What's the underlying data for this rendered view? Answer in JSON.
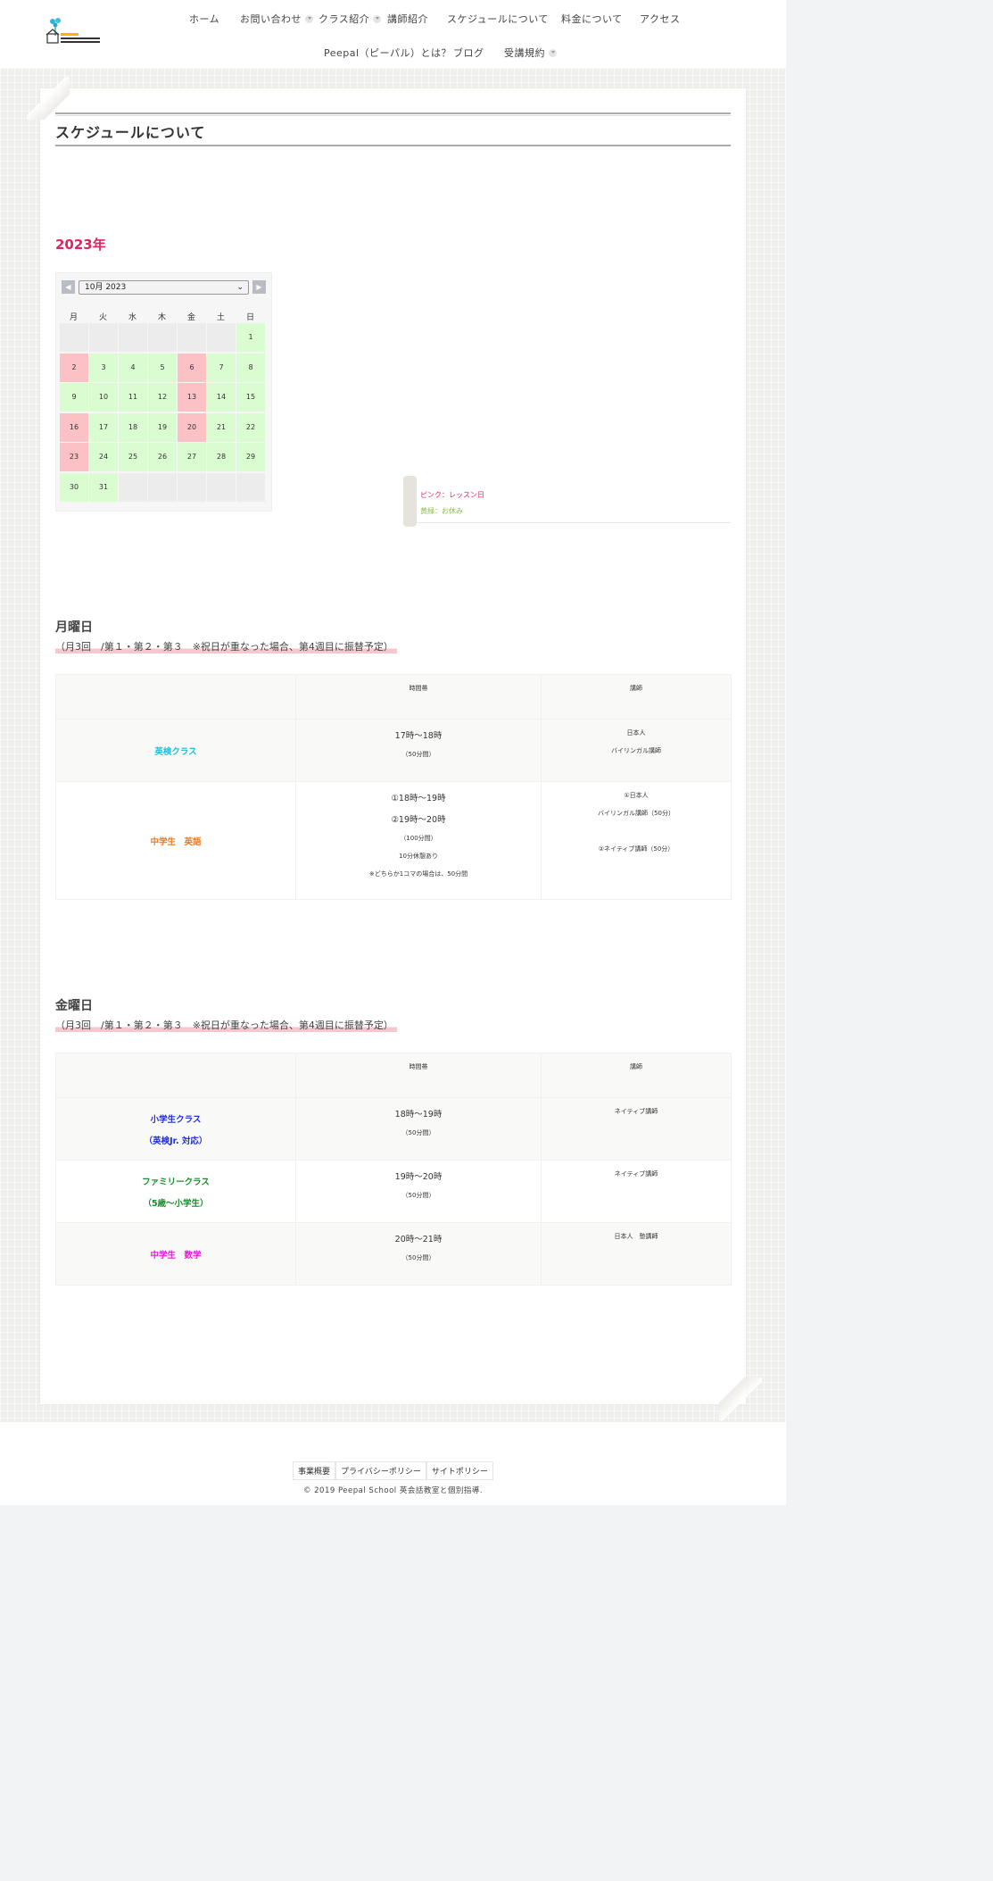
{
  "header": {
    "nav": [
      {
        "label": "ホーム",
        "dropdown": false
      },
      {
        "label": "お問い合わせ",
        "dropdown": true
      },
      {
        "label": "クラス紹介",
        "dropdown": true
      },
      {
        "label": "講師紹介",
        "dropdown": false
      },
      {
        "label": "スケジュールについて",
        "dropdown": false
      },
      {
        "label": "料金について",
        "dropdown": false
      },
      {
        "label": "アクセス",
        "dropdown": false
      },
      {
        "label": "Peepal（ピーパル）とは？",
        "dropdown": false
      },
      {
        "label": "ブログ",
        "dropdown": false
      },
      {
        "label": "受講規約",
        "dropdown": true
      }
    ]
  },
  "page_title": "スケジュールについて",
  "year_heading": "2023年",
  "calendar": {
    "prev_icon": "◀",
    "next_icon": "▶",
    "month_select": "10月 2023",
    "weekdays": [
      "月",
      "火",
      "水",
      "木",
      "金",
      "土",
      "日"
    ],
    "days": [
      {
        "label": "",
        "status": "empty"
      },
      {
        "label": "",
        "status": "empty"
      },
      {
        "label": "",
        "status": "empty"
      },
      {
        "label": "",
        "status": "empty"
      },
      {
        "label": "",
        "status": "empty"
      },
      {
        "label": "",
        "status": "empty"
      },
      {
        "label": "1",
        "status": "off"
      },
      {
        "label": "2",
        "status": "lesson"
      },
      {
        "label": "3",
        "status": "off"
      },
      {
        "label": "4",
        "status": "off"
      },
      {
        "label": "5",
        "status": "off"
      },
      {
        "label": "6",
        "status": "lesson"
      },
      {
        "label": "7",
        "status": "off"
      },
      {
        "label": "8",
        "status": "off"
      },
      {
        "label": "9",
        "status": "off"
      },
      {
        "label": "10",
        "status": "off"
      },
      {
        "label": "11",
        "status": "off"
      },
      {
        "label": "12",
        "status": "off"
      },
      {
        "label": "13",
        "status": "lesson"
      },
      {
        "label": "14",
        "status": "off"
      },
      {
        "label": "15",
        "status": "off"
      },
      {
        "label": "16",
        "status": "lesson"
      },
      {
        "label": "17",
        "status": "off"
      },
      {
        "label": "18",
        "status": "off"
      },
      {
        "label": "19",
        "status": "off"
      },
      {
        "label": "20",
        "status": "lesson"
      },
      {
        "label": "21",
        "status": "off"
      },
      {
        "label": "22",
        "status": "off"
      },
      {
        "label": "23",
        "status": "lesson"
      },
      {
        "label": "24",
        "status": "off"
      },
      {
        "label": "25",
        "status": "off"
      },
      {
        "label": "26",
        "status": "off"
      },
      {
        "label": "27",
        "status": "off"
      },
      {
        "label": "28",
        "status": "off"
      },
      {
        "label": "29",
        "status": "off"
      },
      {
        "label": "30",
        "status": "off"
      },
      {
        "label": "31",
        "status": "off"
      },
      {
        "label": "",
        "status": "empty"
      },
      {
        "label": "",
        "status": "empty"
      },
      {
        "label": "",
        "status": "empty"
      },
      {
        "label": "",
        "status": "empty"
      },
      {
        "label": "",
        "status": "empty"
      }
    ],
    "colors": {
      "lesson": "#fbc1c5",
      "off": "#d9fdd0",
      "empty": "#ececec"
    }
  },
  "legend": {
    "pink": "ピンク：レッスン日",
    "green": "黄緑：お休み"
  },
  "monday": {
    "title": "月曜日",
    "subtitle": "（月3回　/第１・第２・第３　※祝日が重なった場合、第4週目に振替予定）",
    "headers": [
      "",
      "時間帯",
      "講師"
    ],
    "rows": [
      {
        "class_lines": [
          "英検クラス"
        ],
        "class_color": "#1ebde0",
        "time_lines": [
          "17時〜18時",
          "（50分間）"
        ],
        "teacher_lines": [
          "日本人",
          "バイリンガル講師"
        ]
      },
      {
        "class_lines": [
          "中学生　英語"
        ],
        "class_color": "#f07a1a",
        "time_lines": [
          "①18時〜19時",
          "②19時〜20時",
          "（100分間）",
          "10分休憩あり",
          "※どちらか1コマの場合は、50分間"
        ],
        "teacher_lines": [
          "①日本人",
          "バイリンガル講師（50分）",
          "",
          "②ネイティブ講師（50分）"
        ]
      }
    ]
  },
  "friday": {
    "title": "金曜日",
    "subtitle": "（月3回　/第１・第２・第３　※祝日が重なった場合、第4週目に振替予定）",
    "headers": [
      "",
      "時間帯",
      "講師"
    ],
    "rows": [
      {
        "class_lines": [
          "小学生クラス",
          "（英検Jr. 対応）"
        ],
        "class_color": "#1f2ed8",
        "time_lines": [
          "18時〜19時",
          "（50分間）"
        ],
        "teacher_lines": [
          "ネイティブ講師"
        ]
      },
      {
        "class_lines": [
          "ファミリークラス",
          "（5歳〜小学生）"
        ],
        "class_color": "#1c8c2c",
        "time_lines": [
          "19時〜20時",
          "（50分間）"
        ],
        "teacher_lines": [
          "ネイティブ講師"
        ]
      },
      {
        "class_lines": [
          "中学生　数学"
        ],
        "class_color": "#e020d0",
        "time_lines": [
          "20時〜21時",
          "（50分間）"
        ],
        "teacher_lines": [
          "日本人　塾講師"
        ]
      }
    ]
  },
  "footer": {
    "links": [
      "事業概要",
      "プライバシーポリシー",
      "サイトポリシー"
    ],
    "copyright": "© 2019 Peepal School 英会話教室と個別指導."
  }
}
